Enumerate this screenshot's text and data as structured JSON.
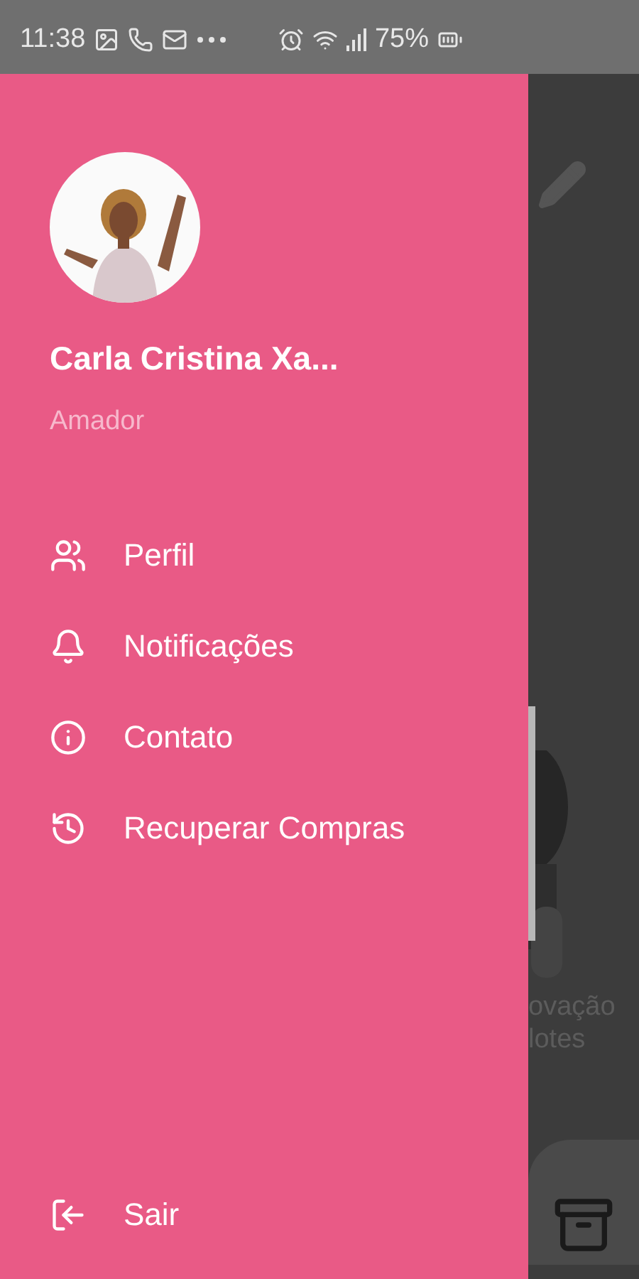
{
  "status_bar": {
    "time": "11:38",
    "battery": "75%"
  },
  "drawer": {
    "user": {
      "name": "Carla Cristina Xa...",
      "level": "Amador"
    },
    "menu": [
      {
        "label": "Perfil",
        "kind": "profile"
      },
      {
        "label": "Notificações",
        "kind": "bell"
      },
      {
        "label": "Contato",
        "kind": "info"
      },
      {
        "label": "Recuperar Compras",
        "kind": "restore"
      }
    ],
    "logout": {
      "label": "Sair"
    }
  },
  "background": {
    "texts": [
      "ovação",
      "lotes"
    ]
  }
}
